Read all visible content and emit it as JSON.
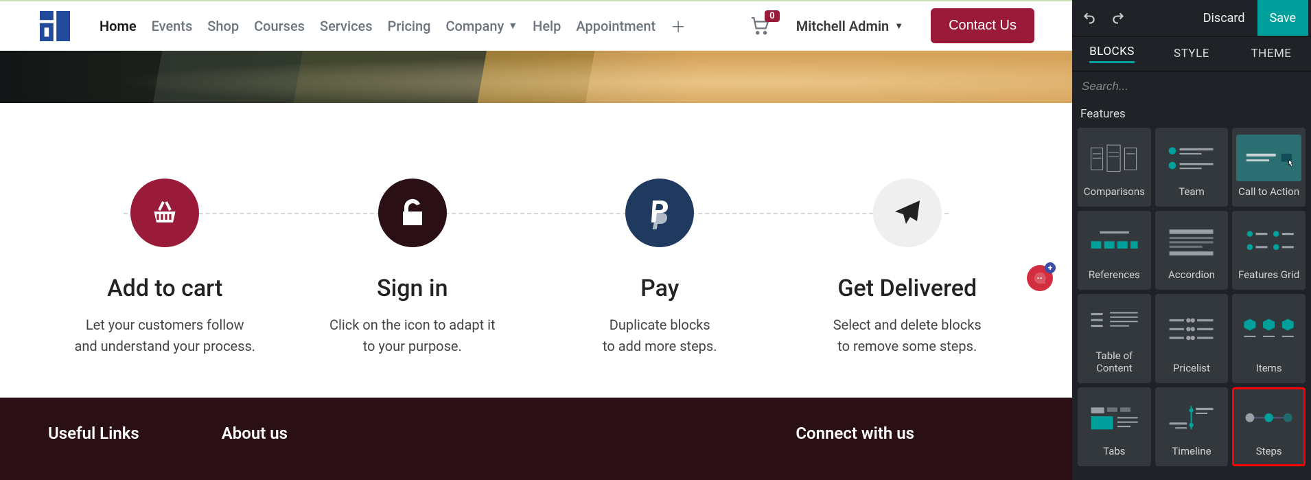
{
  "nav": {
    "items": [
      "Home",
      "Events",
      "Shop",
      "Courses",
      "Services",
      "Pricing",
      "Company",
      "Help",
      "Appointment"
    ],
    "active_index": 0,
    "cart_count": "0",
    "user": "Mitchell Admin",
    "contact": "Contact Us"
  },
  "steps": [
    {
      "title": "Add to cart",
      "desc": "Let your customers follow\nand understand your process."
    },
    {
      "title": "Sign in",
      "desc": "Click on the icon to adapt it\nto your purpose."
    },
    {
      "title": "Pay",
      "desc": "Duplicate blocks\nto add more steps."
    },
    {
      "title": "Get Delivered",
      "desc": "Select and delete blocks\nto remove some steps."
    }
  ],
  "footer": {
    "col1": "Useful Links",
    "col2": "About us",
    "col3": "Connect with us"
  },
  "sidebar": {
    "discard": "Discard",
    "save": "Save",
    "tabs": [
      "BLOCKS",
      "STYLE",
      "THEME"
    ],
    "active_tab": 0,
    "search_placeholder": "Search...",
    "group_title": "Features",
    "cards": [
      "Comparisons",
      "Team",
      "Call to Action",
      "References",
      "Accordion",
      "Features Grid",
      "Table of Content",
      "Pricelist",
      "Items",
      "Tabs",
      "Timeline",
      "Steps"
    ],
    "selected_card": 11,
    "hover_card": 2
  }
}
